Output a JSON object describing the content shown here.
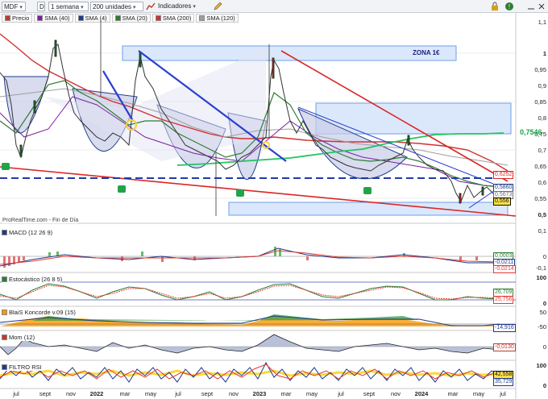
{
  "toolbar": {
    "symbol": "MDF",
    "info": "D",
    "period": "1 semana",
    "units": "200 unidades",
    "indicators": "Indicadores"
  },
  "legend": [
    {
      "label": "Precio",
      "color": "#c0392b"
    },
    {
      "label": "SMA (40)",
      "color": "#7b1fa2"
    },
    {
      "label": "SMA (4)",
      "color": "#1e3a8a"
    },
    {
      "label": "SMA (20)",
      "color": "#2e7d32"
    },
    {
      "label": "SMA (200)",
      "color": "#d32f2f"
    },
    {
      "label": "SMA (120)",
      "color": "#9e9e9e"
    }
  ],
  "price_axis": [
    "1,1",
    "1",
    "0,95",
    "0,9",
    "0,85",
    "0,8",
    "0,75",
    "0,7",
    "0,65",
    "0,6",
    "0,55",
    "0,5"
  ],
  "price_tags": [
    {
      "label": "0,7546",
      "color": "#16a34a"
    },
    {
      "label": "0,6252",
      "color": "#dc2626"
    },
    {
      "label": "0,5860",
      "color": "#1e3a8a"
    },
    {
      "label": "0,5673",
      "color": "#6b7280"
    },
    {
      "label": "0,556",
      "color": "#111111"
    }
  ],
  "zone_label": "ZONA 1€",
  "source": "ProRealTime.com - Fin de Día",
  "panels": [
    {
      "title": "MACD (12 26 9)",
      "axis": [
        "0,1",
        "0",
        "-0,1"
      ],
      "tags": [
        "0,0003",
        "-0,0211",
        "-0,0214"
      ]
    },
    {
      "title": "Estocástico (26 8 5)",
      "axis": [
        "100",
        "0"
      ],
      "tags": [
        "26,709",
        "25,756"
      ]
    },
    {
      "title": "BlaiS Koncorde v.09 (15)",
      "axis": [
        "50",
        "-50"
      ],
      "tags": [
        "-14,916"
      ]
    },
    {
      "title": "Mom (12)",
      "axis": [
        "0"
      ],
      "tags": [
        "-0,0130"
      ]
    },
    {
      "title": "FILTRO RSI",
      "axis": [
        "100",
        "0"
      ],
      "tags": [
        "42,558",
        "35,729"
      ]
    }
  ],
  "x_axis": [
    {
      "label": "jul",
      "bold": false
    },
    {
      "label": "sept",
      "bold": false
    },
    {
      "label": "nov",
      "bold": false
    },
    {
      "label": "2022",
      "bold": true
    },
    {
      "label": "mar",
      "bold": false
    },
    {
      "label": "may",
      "bold": false
    },
    {
      "label": "jul",
      "bold": false
    },
    {
      "label": "sept",
      "bold": false
    },
    {
      "label": "nov",
      "bold": false
    },
    {
      "label": "2023",
      "bold": true
    },
    {
      "label": "mar",
      "bold": false
    },
    {
      "label": "may",
      "bold": false
    },
    {
      "label": "jul",
      "bold": false
    },
    {
      "label": "sept",
      "bold": false
    },
    {
      "label": "nov",
      "bold": false
    },
    {
      "label": "2024",
      "bold": true
    },
    {
      "label": "mar",
      "bold": false
    },
    {
      "label": "may",
      "bold": false
    },
    {
      "label": "jul",
      "bold": false
    }
  ]
}
